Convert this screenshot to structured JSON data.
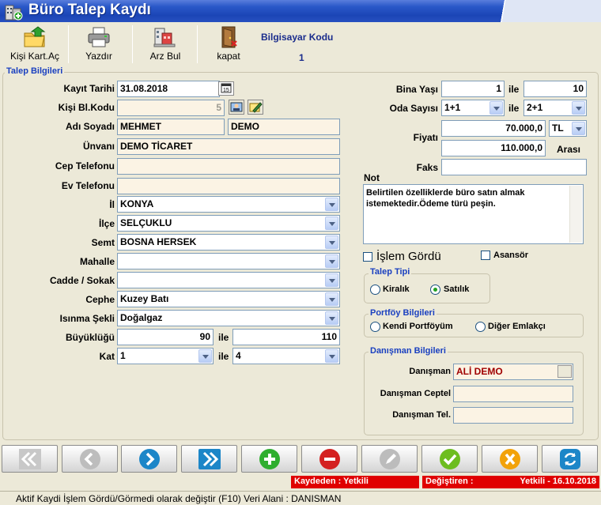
{
  "window": {
    "title": "Büro Talep Kaydı"
  },
  "toolbar": {
    "buttons": [
      {
        "label": "Kişi Kart.Aç",
        "icon": "open-card-icon"
      },
      {
        "label": "Yazdır",
        "icon": "printer-icon"
      },
      {
        "label": "Arz Bul",
        "icon": "search-offer-icon"
      },
      {
        "label": "kapat",
        "icon": "exit-door-icon"
      }
    ],
    "computer_code_label": "Bilgisayar Kodu",
    "computer_code_value": "1"
  },
  "talep": {
    "legend": "Talep Bilgileri",
    "kayit_tarihi_label": "Kayıt Tarihi",
    "kayit_tarihi": "31.08.2018",
    "kisi_bl_kodu_label": "Kişi Bl.Kodu",
    "kisi_bl_kodu": "5",
    "adi_soyadi_label": "Adı Soyadı",
    "adi": "MEHMET",
    "soyadi": "DEMO",
    "unvani_label": "Ünvanı",
    "unvani": "DEMO TİCARET",
    "cep_label": "Cep Telefonu",
    "cep": "",
    "ev_label": "Ev Telefonu",
    "ev": "",
    "il_label": "İl",
    "il": "KONYA",
    "ilce_label": "İlçe",
    "ilce": "SELÇUKLU",
    "semt_label": "Semt",
    "semt": "BOSNA HERSEK",
    "mahalle_label": "Mahalle",
    "mahalle": "",
    "cadde_label": "Cadde / Sokak",
    "cadde": "",
    "cephe_label": "Cephe",
    "cephe": "Kuzey Batı",
    "isinma_label": "Isınma Şekli",
    "isinma": "Doğalgaz",
    "buyukluk_label": "Büyüklüğü",
    "buyukluk_min": "90",
    "ile": "ile",
    "buyukluk_max": "110",
    "kat_label": "Kat",
    "kat_min": "1",
    "kat_max": "4",
    "bina_yasi_label": "Bina Yaşı",
    "bina_yasi_min": "1",
    "bina_yasi_max": "10",
    "oda_label": "Oda Sayısı",
    "oda_min": "1+1",
    "oda_max": "2+1",
    "fiyat_label": "Fiyatı",
    "fiyat_min": "70.000,0",
    "currency": "TL",
    "fiyat_max": "110.000,0",
    "arasi": "Arası",
    "faks_label": "Faks",
    "faks": "",
    "not_label": "Not",
    "not": "Belirtilen özelliklerde büro satın almak istemektedir.Ödeme türü peşin.",
    "islem_gordu_label": "İşlem Gördü",
    "asansor_label": "Asansör"
  },
  "talep_tipi": {
    "legend": "Talep Tipi",
    "kiralik": "Kiralık",
    "satilik": "Satılık",
    "selected": "satilik"
  },
  "portfoy": {
    "legend": "Portföy Bilgileri",
    "kendi": "Kendi Portföyüm",
    "diger": "Diğer Emlakçı"
  },
  "danisman": {
    "legend": "Danışman Bilgileri",
    "danisman_label": "Danışman",
    "danisman": "ALİ DEMO",
    "ceptel_label": "Danışman Ceptel",
    "ceptel": "",
    "tel_label": "Danışman Tel.",
    "tel": ""
  },
  "nav": {
    "buttons": [
      "first-record-button",
      "previous-record-button",
      "next-record-button",
      "last-record-button",
      "add-button",
      "delete-button",
      "edit-button",
      "save-button",
      "cancel-button",
      "refresh-button"
    ]
  },
  "status": {
    "kaydeden": "Kaydeden : Yetkili",
    "degistiren": "Değiştiren :",
    "degistiren_value": "Yetkili - 16.10.2018",
    "hint": "Aktif Kaydi İşlem Gördü/Görmedi olarak değiştir (F10) Veri Alani : DANISMAN"
  }
}
